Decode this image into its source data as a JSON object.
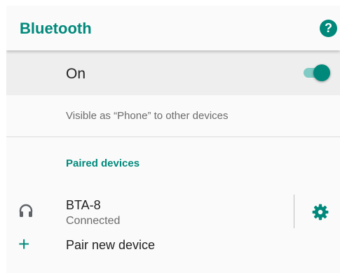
{
  "appbar": {
    "title": "Bluetooth",
    "help_icon": "help-icon",
    "help_glyph": "?"
  },
  "master": {
    "label": "On",
    "state": "on"
  },
  "visibility_text": "Visible as “Phone” to other devices",
  "paired_section": {
    "header": "Paired devices",
    "devices": [
      {
        "name": "BTA-8",
        "status": "Connected",
        "icon": "headset-icon",
        "settings_icon": "gear-icon"
      }
    ]
  },
  "pair_new": {
    "label": "Pair new device",
    "icon": "plus-icon",
    "glyph": "+"
  },
  "colors": {
    "accent": "#00897b",
    "accent_light": "#80cbc4",
    "master_bg": "#eeeeee"
  }
}
